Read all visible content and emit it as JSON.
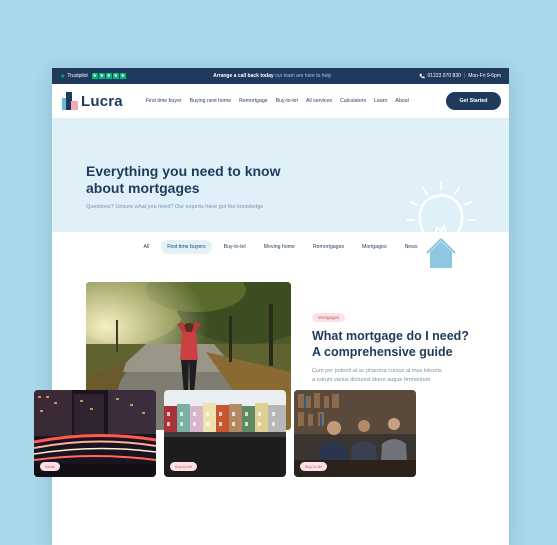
{
  "topbar": {
    "trustpilot_label": "Trustpilot",
    "rating_stars": 5,
    "callback_bold": "Arrange a call back today",
    "callback_rest": "our team are here to help",
    "phone": "01223 970 830",
    "separator": "|",
    "hours": "Mon-Fri 9-6pm"
  },
  "nav": {
    "logo_text": "Lucra",
    "items": [
      "First time buyer",
      "Buying next home",
      "Remortgage",
      "Buy-to-let",
      "All services",
      "Calculators",
      "Learn",
      "About"
    ],
    "cta_label": "Get Started"
  },
  "hero": {
    "title_line1": "Everything you need to know",
    "title_line2": "about mortgages",
    "subtitle": "Questions? Unsure what you need? Our experts have got the knowledge"
  },
  "filters": {
    "items": [
      "All",
      "First time buyers",
      "Buy-to-let",
      "Moving home",
      "Remortgages",
      "Mortgages",
      "News"
    ],
    "active": "First time buyers"
  },
  "featured": {
    "badge": "Mortgages",
    "title_line1": "What mortgage do I need?",
    "title_line2": "A comprehensive guide",
    "excerpt_line1": "Cum per potenti at ac pharetra cursus at mus lobortis",
    "excerpt_line2": "a rutrum varius dictumst libero augue fermentum"
  },
  "cards": [
    {
      "badge": "News"
    },
    {
      "badge": "Buy-to-let"
    },
    {
      "badge": "Buy-to-let"
    }
  ],
  "colors": {
    "navy": "#1f3a5c",
    "hero_bg": "#dff0f8",
    "page_bg": "#a8d8ea",
    "trustpilot_green": "#00b67a",
    "badge_bg": "#fbe1e5",
    "badge_text": "#c8566a"
  }
}
